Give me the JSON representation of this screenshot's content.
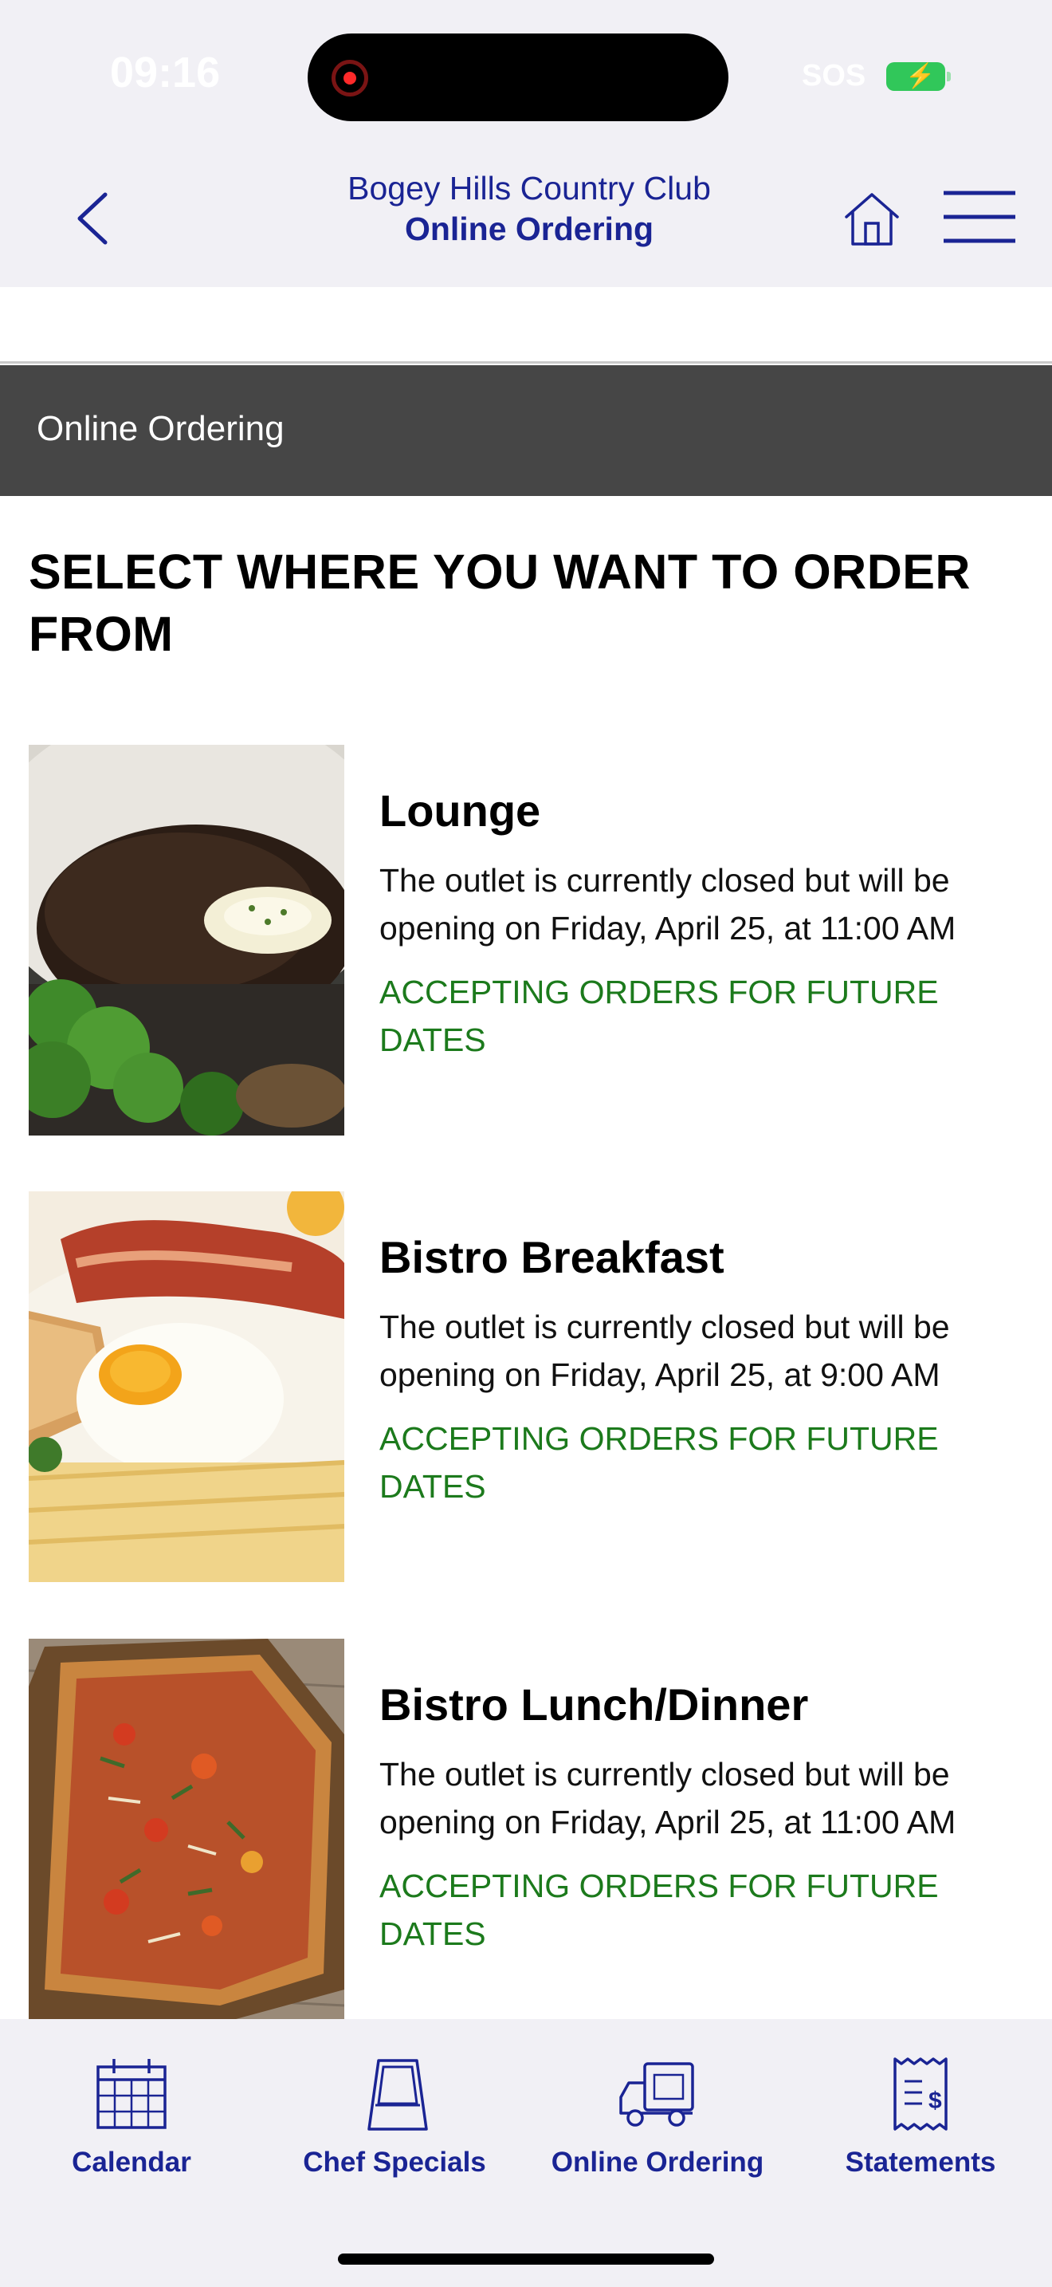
{
  "status_bar": {
    "time": "09:16",
    "carrier": "SOS"
  },
  "header": {
    "club_name": "Bogey Hills Country Club",
    "subtitle": "Online Ordering"
  },
  "section": {
    "title": "Online Ordering"
  },
  "page": {
    "heading": "SELECT WHERE YOU WANT TO ORDER FROM"
  },
  "outlets": [
    {
      "name": "Lounge",
      "status": "The outlet is currently closed but will be opening on Friday, April 25, at 11:00 AM",
      "accepting": "ACCEPTING ORDERS FOR FUTURE DATES"
    },
    {
      "name": "Bistro Breakfast",
      "status": "The outlet is currently closed but will be opening on Friday, April 25, at 9:00 AM",
      "accepting": "ACCEPTING ORDERS FOR FUTURE DATES"
    },
    {
      "name": "Bistro Lunch/Dinner",
      "status": "The outlet is currently closed but will be opening on Friday, April 25, at 11:00 AM",
      "accepting": "ACCEPTING ORDERS FOR FUTURE DATES"
    }
  ],
  "tabs": [
    {
      "label": "Calendar",
      "icon": "calendar-icon"
    },
    {
      "label": "Chef Specials",
      "icon": "sign-board-icon"
    },
    {
      "label": "Online Ordering",
      "icon": "delivery-truck-icon"
    },
    {
      "label": "Statements",
      "icon": "receipt-icon"
    }
  ],
  "colors": {
    "brand": "#1a2494",
    "accept_green": "#1c7a1c",
    "section_bar": "#464646",
    "chrome_bg": "#f1f0f5"
  }
}
